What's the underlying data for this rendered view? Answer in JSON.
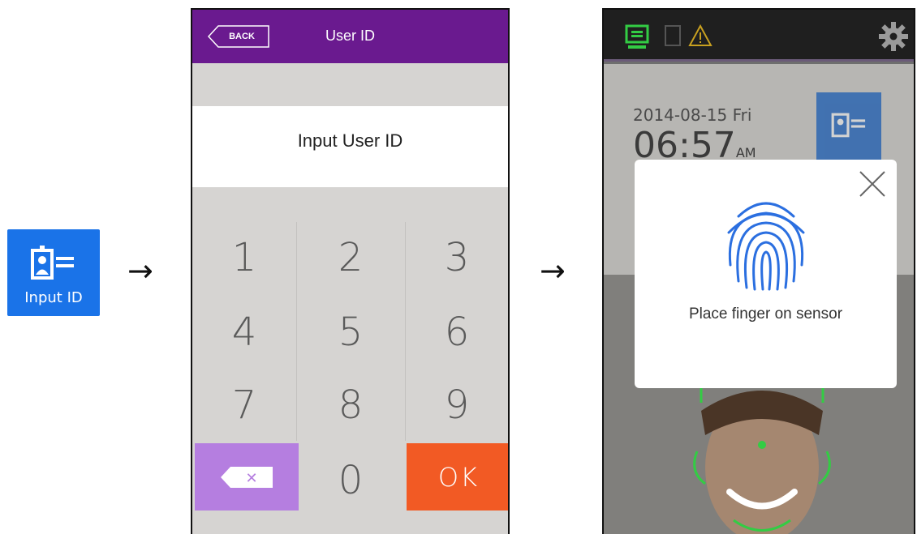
{
  "input_id_tile": {
    "label": "Input ID"
  },
  "arrows": [
    "→",
    "→"
  ],
  "keypad_screen": {
    "back_label": "BACK",
    "title": "User ID",
    "input_label": "Input User ID",
    "keys": [
      "1",
      "2",
      "3",
      "4",
      "5",
      "6",
      "7",
      "8",
      "9",
      "0"
    ],
    "delete_symbol": "✕",
    "ok_label": "OK"
  },
  "device_screen": {
    "date": "2014-08-15 Fri",
    "time": "06:57",
    "time_suffix": "AM",
    "modal_message": "Place finger on sensor"
  },
  "colors": {
    "tile_blue": "#1a73e8",
    "header_purple": "#6a1a8f",
    "delete_purple": "#b57ee0",
    "ok_orange": "#f25a24",
    "fingerprint_blue": "#2b6fe0",
    "face_guide_green": "#33cc44"
  }
}
